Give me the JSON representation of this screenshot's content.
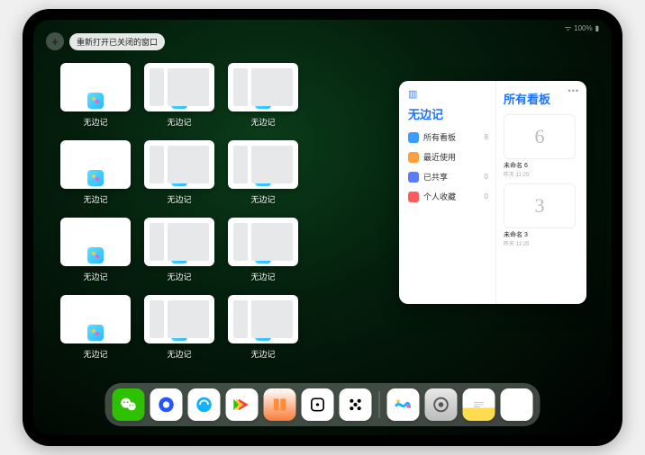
{
  "status": {
    "signal": "📶",
    "battery": "100%",
    "wifi": "📡"
  },
  "topbar": {
    "plus": "+",
    "reopen_label": "重新打开已关闭的窗口"
  },
  "thumb_label": "无边记",
  "thumbs": [
    {
      "content": false
    },
    {
      "content": true
    },
    {
      "content": true
    },
    null,
    {
      "content": false
    },
    {
      "content": true
    },
    {
      "content": true
    },
    null,
    {
      "content": false
    },
    {
      "content": true
    },
    {
      "content": true
    },
    null,
    {
      "content": false
    },
    {
      "content": true
    },
    {
      "content": true
    },
    null
  ],
  "panel": {
    "title": "无边记",
    "right_title": "所有看板",
    "menu": [
      {
        "label": "所有看板",
        "count": "8",
        "color": "mi-blue"
      },
      {
        "label": "最近使用",
        "count": "",
        "color": "mi-orange"
      },
      {
        "label": "已共享",
        "count": "0",
        "color": "mi-indigo"
      },
      {
        "label": "个人收藏",
        "count": "0",
        "color": "mi-red"
      }
    ],
    "boards": [
      {
        "glyph": "6",
        "label": "未命名 6",
        "sub": "昨天 11:25"
      },
      {
        "glyph": "3",
        "label": "未命名 3",
        "sub": "昨天 11:25"
      }
    ]
  },
  "dock": [
    {
      "name": "wechat",
      "class": "d-wechat"
    },
    {
      "name": "tencent-video",
      "class": "d-qq1"
    },
    {
      "name": "qq-browser",
      "class": "d-qq2"
    },
    {
      "name": "video-play",
      "class": "d-video"
    },
    {
      "name": "books",
      "class": "d-books"
    },
    {
      "name": "game-dice",
      "class": "d-dice"
    },
    {
      "name": "app-dots",
      "class": "d-dots"
    }
  ],
  "dock_recent": [
    {
      "name": "freeform",
      "class": "d-freeform"
    },
    {
      "name": "settings",
      "class": "d-settings"
    },
    {
      "name": "notes",
      "class": "d-notes"
    },
    {
      "name": "app-library",
      "class": "d-multi"
    }
  ]
}
